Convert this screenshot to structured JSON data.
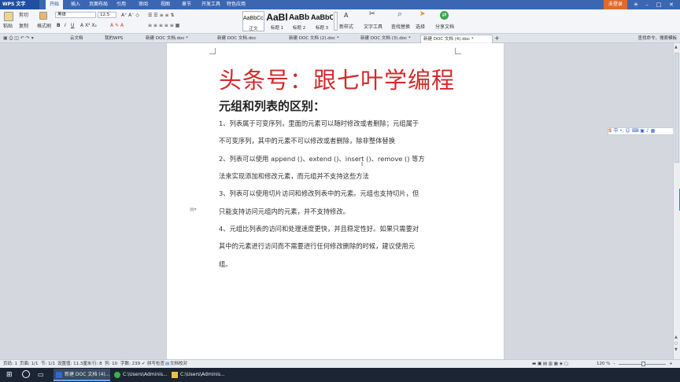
{
  "app": {
    "name": "WPS 文字",
    "login": "未登录"
  },
  "menu": [
    "开始",
    "插入",
    "页面布局",
    "引用",
    "审阅",
    "视图",
    "章节",
    "开发工具",
    "特色应用"
  ],
  "ribbon": {
    "paste": "粘贴",
    "cut": "剪切",
    "copy": "复制",
    "format_painter": "格式刷",
    "font": "黑体",
    "font_size": "12.5",
    "styles": [
      {
        "preview": "AaBbCcDd",
        "label": "正文"
      },
      {
        "preview": "AaBl",
        "label": "标题 1"
      },
      {
        "preview": "AaBb",
        "label": "标题 2"
      },
      {
        "preview": "AaBbC",
        "label": "标题 3"
      }
    ],
    "new_style": "新样式",
    "text_tools": "文字工具",
    "find_replace": "查找替换",
    "select": "选择",
    "share": "分享文档"
  },
  "tabs": [
    {
      "label": "云文档"
    },
    {
      "label": "我的WPS"
    },
    {
      "label": "新建 DOC 文档.doc *"
    },
    {
      "label": "新建 DOC 文档.doc"
    },
    {
      "label": "新建 DOC 文档 (2).doc *"
    },
    {
      "label": "新建 DOC 文档 (3).doc *"
    },
    {
      "label": "新建 DOC 文档 (4).doc *"
    }
  ],
  "search_hint": "查找命令、搜索模板",
  "doc": {
    "headline": "头条号：跟七叶学编程",
    "subhead": "元组和列表的区别：",
    "lines": [
      "1、列表属于可变序列，里面的元素可以随时修改或者删除；元组属于",
      "不可变序列，其中的元素不可以修改或者删除，除非整体替换",
      "2、列表可以使用 append ()、extend ()、insert ()、remove () 等方",
      "法来实现添加和修改元素，而元组并不支持这些方法",
      "3、列表可以使用切片访问和修改列表中的元素。元组也支持切片，但",
      "只能支持访问元组内的元素，并不支持修改。",
      "4、元组比列表的访问和处理速度更快，并且稳定性好。如果只需要对",
      "其中的元素进行访问而不需要进行任何修改删除的时候，建议使用元",
      "组。"
    ]
  },
  "status": {
    "pages": "页码: 1",
    "page_of": "页面: 1/1",
    "section": "节: 1/1",
    "position": "设置值: 11.3厘米",
    "row": "行: 8",
    "column": "列: 10",
    "words": "字数: 239",
    "spell": "拼写检查",
    "doc_check": "文档校对",
    "zoom": "120 %"
  },
  "taskbar": [
    {
      "label": "新建 DOC 文档 (4)..."
    },
    {
      "label": "C:\\Users\\Adminis..."
    },
    {
      "label": "C:\\Users\\Adminis..."
    }
  ],
  "ime": "中"
}
